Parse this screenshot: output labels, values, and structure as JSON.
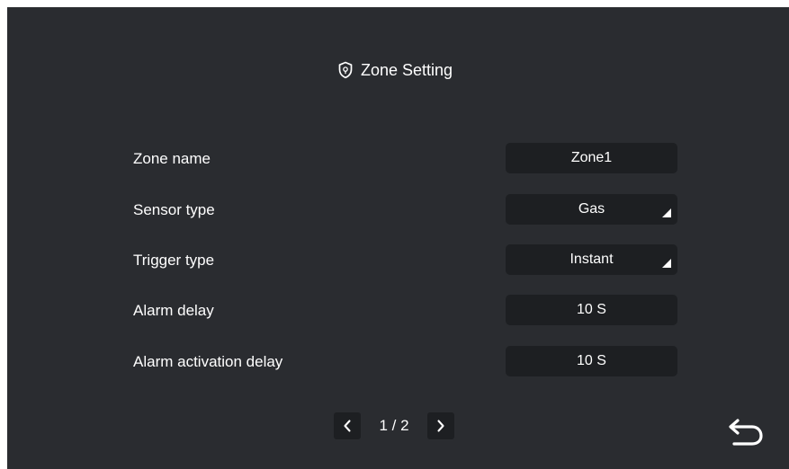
{
  "title": "Zone Setting",
  "icons": {
    "title": "shield-lock-icon",
    "previous": "chevron-left-icon",
    "next": "chevron-right-icon",
    "back": "back-arrow-icon"
  },
  "colors": {
    "background": "#2a2c30",
    "field_background": "#1d1f22",
    "text": "#ffffff"
  },
  "settings": [
    {
      "label": "Zone name",
      "value": "Zone1",
      "type": "text"
    },
    {
      "label": "Sensor type",
      "value": "Gas",
      "type": "dropdown"
    },
    {
      "label": "Trigger type",
      "value": "Instant",
      "type": "dropdown"
    },
    {
      "label": "Alarm delay",
      "value": "10 S",
      "type": "value"
    },
    {
      "label": "Alarm activation delay",
      "value": "10 S",
      "type": "value"
    }
  ],
  "pagination": {
    "current": "1 / 2"
  }
}
